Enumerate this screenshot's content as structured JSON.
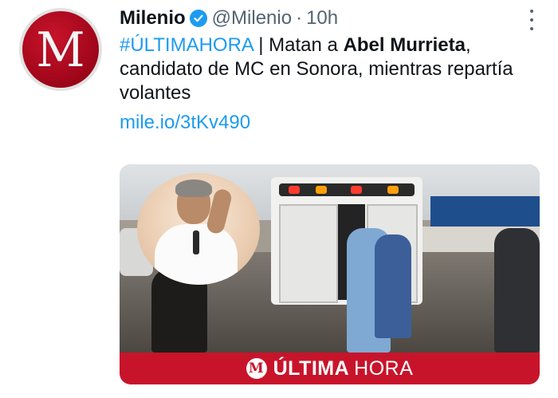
{
  "tweet": {
    "avatar_letter": "M",
    "name": "Milenio",
    "handle": "@Milenio",
    "separator": "·",
    "time": "10h",
    "text_parts": {
      "hashtag": "#ÚLTIMAHORA",
      "plain_1": " | Matan a ",
      "bold_name": "Abel Murrieta",
      "plain_2": ", candidato de MC en Sonora, mientras repartía volantes"
    },
    "link": "mile.io/3tKv490",
    "banner": {
      "logo_letter": "M",
      "word_1": "ÚLTIMA",
      "word_2": "HORA"
    }
  },
  "colors": {
    "brand_red": "#c8142a",
    "link_blue": "#1d9bf0",
    "secondary_text": "#536471"
  },
  "icons": {
    "verified": "verified-badge-icon",
    "more": "more-options-icon"
  }
}
